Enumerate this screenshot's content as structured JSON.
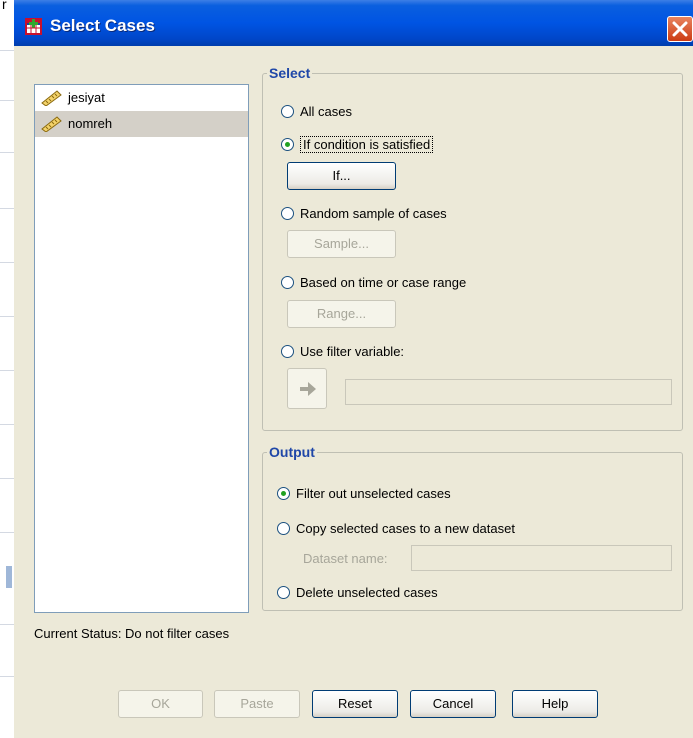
{
  "window": {
    "title": "Select Cases",
    "icon": "spss-select-cases-icon",
    "close_icon": "close-icon"
  },
  "background": {
    "row_fragment": "r"
  },
  "variables": [
    {
      "name": "jesiyat",
      "icon": "ruler-scale-icon",
      "selected": false
    },
    {
      "name": "nomreh",
      "icon": "ruler-scale-icon",
      "selected": true
    }
  ],
  "select_group": {
    "legend": "Select",
    "options": [
      {
        "label": "All cases",
        "checked": false
      },
      {
        "label": "If condition is satisfied",
        "checked": true
      },
      {
        "label": "Random sample of cases",
        "checked": false
      },
      {
        "label": "Based on time or case range",
        "checked": false
      },
      {
        "label": "Use filter variable:",
        "checked": false
      }
    ],
    "if_button": "If...",
    "sample_button": "Sample...",
    "range_button": "Range...",
    "arrow_icon": "arrow-right-icon",
    "filter_variable_value": ""
  },
  "output_group": {
    "legend": "Output",
    "options": [
      {
        "label": "Filter out unselected cases",
        "checked": true
      },
      {
        "label": "Copy selected cases to a new dataset",
        "checked": false
      },
      {
        "label": "Delete unselected cases",
        "checked": false
      }
    ],
    "dataset_name_label": "Dataset name:",
    "dataset_name_value": ""
  },
  "status": "Current Status: Do not filter cases",
  "buttons": {
    "ok": "OK",
    "paste": "Paste",
    "reset": "Reset",
    "cancel": "Cancel",
    "help": "Help"
  },
  "colors": {
    "title_bar": "#0054e3",
    "legend": "#1f47a8",
    "dialog_bg": "#ece9d8",
    "radio_dot": "#21a121"
  }
}
